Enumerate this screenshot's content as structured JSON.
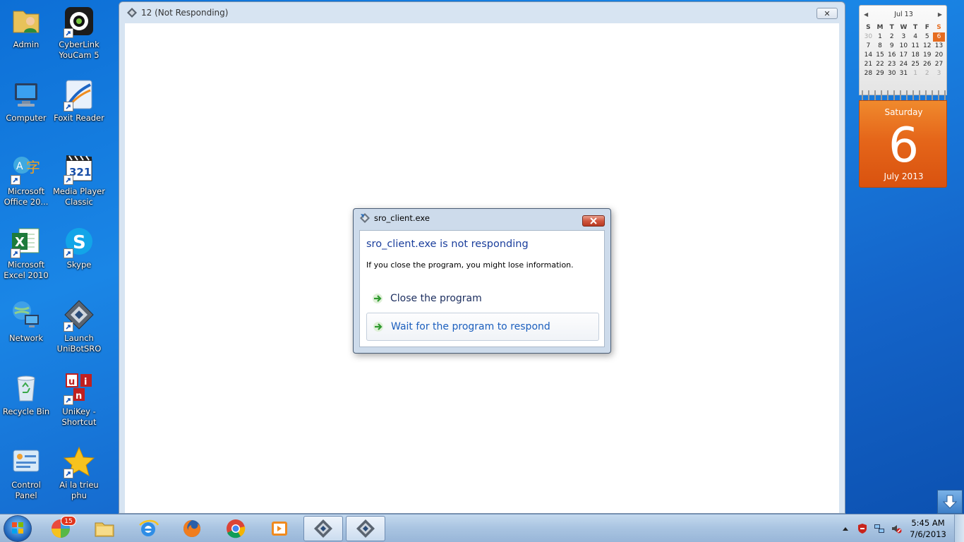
{
  "desktop": {
    "icons_col1": [
      {
        "label": "Admin",
        "icon": "user-folder-icon",
        "shortcut": false
      },
      {
        "label": "Computer",
        "icon": "computer-icon",
        "shortcut": false
      },
      {
        "label": "Microsoft Office 20...",
        "icon": "office-language-icon",
        "shortcut": true
      },
      {
        "label": "Microsoft Excel 2010",
        "icon": "excel-icon",
        "shortcut": true
      },
      {
        "label": "Network",
        "icon": "network-icon",
        "shortcut": false
      },
      {
        "label": "Recycle Bin",
        "icon": "recycle-bin-icon",
        "shortcut": false
      },
      {
        "label": "Control Panel",
        "icon": "control-panel-icon",
        "shortcut": false
      }
    ],
    "icons_col2": [
      {
        "label": "CyberLink YouCam 5",
        "icon": "webcam-icon",
        "shortcut": true
      },
      {
        "label": "Foxit Reader",
        "icon": "pdf-reader-icon",
        "shortcut": true
      },
      {
        "label": "Media Player Classic",
        "icon": "media-player-icon",
        "shortcut": true
      },
      {
        "label": "Skype",
        "icon": "skype-icon",
        "shortcut": true
      },
      {
        "label": "Launch UniBotSRO",
        "icon": "unibot-icon",
        "shortcut": true
      },
      {
        "label": "UniKey - Shortcut",
        "icon": "unikey-icon",
        "shortcut": true
      },
      {
        "label": "Ai la trieu phu",
        "icon": "star-icon",
        "shortcut": true
      }
    ]
  },
  "app_window": {
    "title": "12 (Not Responding)",
    "close_glyph": "✕"
  },
  "dialog": {
    "title": "sro_client.exe",
    "main_instruction": "sro_client.exe is not responding",
    "sub_text": "If you close the program, you might lose information.",
    "close_program_label": "Close the program",
    "wait_label": "Wait for the program to respond"
  },
  "calendar": {
    "header": "Jul 13",
    "days_of_week": [
      "S",
      "M",
      "T",
      "W",
      "T",
      "F",
      "S"
    ],
    "weeks": [
      [
        "30",
        "1",
        "2",
        "3",
        "4",
        "5",
        "6"
      ],
      [
        "7",
        "8",
        "9",
        "10",
        "11",
        "12",
        "13"
      ],
      [
        "14",
        "15",
        "16",
        "17",
        "18",
        "19",
        "20"
      ],
      [
        "21",
        "22",
        "23",
        "24",
        "25",
        "26",
        "27"
      ],
      [
        "28",
        "29",
        "30",
        "31",
        "1",
        "2",
        "3"
      ]
    ],
    "weekday": "Saturday",
    "day": "6",
    "month_year": "July 2013"
  },
  "taskbar": {
    "badge_count": "15",
    "clock_time": "5:45 AM",
    "clock_date": "7/6/2013"
  },
  "colors": {
    "desktop_blue": "#1a86e6",
    "dialog_heading": "#1a3e9c",
    "calendar_orange": "#e5661a",
    "close_red": "#c84a30"
  }
}
